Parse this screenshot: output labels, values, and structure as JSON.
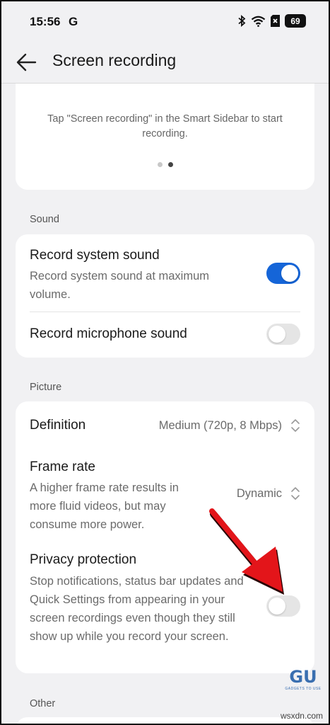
{
  "status_bar": {
    "time": "15:56",
    "notification_letter": "G",
    "battery": "69",
    "icons": [
      "bluetooth-icon",
      "wifi-icon",
      "sim-off-icon",
      "battery-icon"
    ]
  },
  "header": {
    "title": "Screen recording",
    "back_icon": "back-arrow-icon"
  },
  "intro": {
    "text": "Tap \"Screen recording\" in the Smart Sidebar to start recording.",
    "page_indicator": {
      "count": 2,
      "active": 2
    }
  },
  "sound": {
    "label": "Sound",
    "items": [
      {
        "title": "Record system sound",
        "subtitle": "Record system sound at maximum volume.",
        "enabled": true
      },
      {
        "title": "Record microphone sound",
        "enabled": false
      }
    ]
  },
  "picture": {
    "label": "Picture",
    "items": [
      {
        "title": "Definition",
        "value": "Medium (720p, 8 Mbps)"
      },
      {
        "title": "Frame rate",
        "subtitle": "A higher frame rate results in more fluid videos, but may consume more power.",
        "value": "Dynamic"
      },
      {
        "title": "Privacy protection",
        "subtitle": "Stop notifications, status bar updates and Quick Settings from appearing in your screen recordings even though they still show up while you record your screen.",
        "enabled": false
      }
    ]
  },
  "other": {
    "label": "Other"
  },
  "colors": {
    "accent": "#1565d8",
    "background": "#f1f1f3",
    "card": "#ffffff",
    "annotation_arrow": "#e3151a"
  },
  "watermark": {
    "logo": "GU",
    "tagline": "GADGETS TO USE",
    "site": "wsxdn.com"
  }
}
